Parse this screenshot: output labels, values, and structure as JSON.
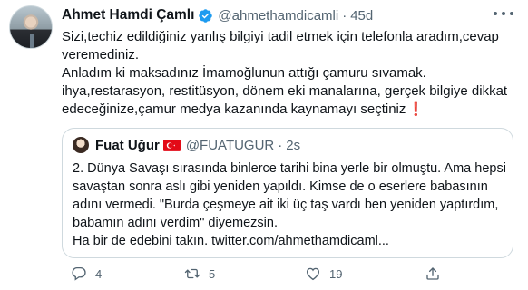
{
  "tweet": {
    "author_name": "Ahmet Hamdi Çamlı",
    "author_handle": "@ahmethamdicamli",
    "time": "45d",
    "text_lines": [
      "Sizi,techiz edildiğiniz yanlış bilgiyi tadil etmek için telefonla aradım,cevap",
      "veremediniz.",
      "Anladım ki maksadınız İmamoğlunun attığı çamuru sıvamak.",
      "ihya,restarasyon, restitüsyon, dönem eki manalarına, gerçek bilgiye dikkat",
      "edeceğinize,çamur medya kazanında kaynamayı seçtiniz"
    ],
    "emoji_end": "❗",
    "icons": [
      "verified-badge-icon",
      "more-options-icon"
    ]
  },
  "quoted_tweet": {
    "author_name": "Fuat Uğur",
    "author_handle": "@FUATUGUR",
    "time": "2s",
    "flag": "turkey-flag-icon",
    "text_lines": [
      "2. Dünya Savaşı sırasında binlerce tarihi bina yerle bir olmuştu. Ama hepsi",
      "savaştan sonra aslı gibi yeniden yapıldı. Kimse de o eserlere babasının",
      "adını vermedi. \"Burda çeşmeye ait iki üç taş vardı ben yeniden yaptırdım,",
      "babamın adını verdim\" diyemezsin.",
      "Ha bir de edebini takın. twitter.com/ahmethamdicaml..."
    ]
  },
  "actions": {
    "reply_count": "4",
    "retweet_count": "5",
    "like_count": "19",
    "icons": [
      "reply-icon",
      "retweet-icon",
      "like-icon",
      "share-icon"
    ]
  },
  "colors": {
    "text": "#0f1419",
    "secondary": "#536471",
    "verified": "#1d9bf0",
    "border": "#cfd9de",
    "flag_red": "#e30a17"
  }
}
